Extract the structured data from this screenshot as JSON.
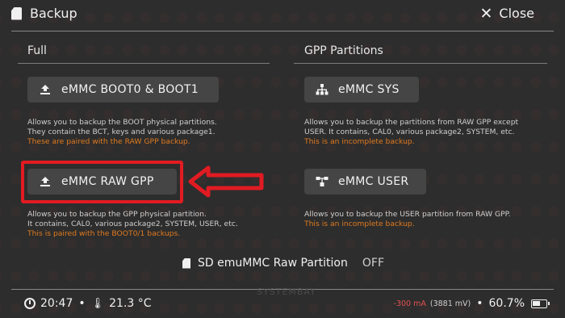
{
  "header": {
    "title": "Backup",
    "close_label": "Close"
  },
  "full": {
    "title": "Full",
    "boot_button": "eMMC BOOT0 & BOOT1",
    "boot_desc_1": "Allows you to backup the BOOT physical partitions.",
    "boot_desc_2": "They contain the BCT, keys and various package1.",
    "boot_desc_warn": "These are paired with the RAW GPP backup.",
    "rawgpp_button": "eMMC RAW GPP",
    "rawgpp_desc_1": "Allows you to backup the GPP physical partition.",
    "rawgpp_desc_2": "It contains, CAL0, various package2, SYSTEM, USER, etc.",
    "rawgpp_desc_warn": "This is paired with the BOOT0/1 backups."
  },
  "gpp": {
    "title": "GPP Partitions",
    "sys_button": "eMMC SYS",
    "sys_desc_1": "Allows you to backup the partitions from RAW GPP except",
    "sys_desc_2": "USER. It contains, CAL0, various package2, SYSTEM, etc.",
    "sys_desc_warn": "This is an incomplete backup.",
    "user_button": "eMMC USER",
    "user_desc_1": "Allows you to backup the USER partition from RAW GPP.",
    "user_desc_warn": "This is an incomplete backup."
  },
  "emummc": {
    "label": "SD emuMMC Raw Partition",
    "state": "OFF"
  },
  "status": {
    "time": "20:47",
    "temperature": "21.3 °C",
    "current": "-300 mA",
    "voltage": "(3881 mV)",
    "battery": "60.7%"
  },
  "icons": {
    "title": "sd-card-icon",
    "close": "close-icon",
    "boot": "upload-icon",
    "rawgpp": "upload-icon",
    "sys": "hierarchy-icon",
    "user": "share-icon",
    "emummc": "sd-card-icon"
  },
  "colors": {
    "highlight": "#e11b22",
    "warning": "#e07a1f",
    "current": "#e05050"
  }
}
